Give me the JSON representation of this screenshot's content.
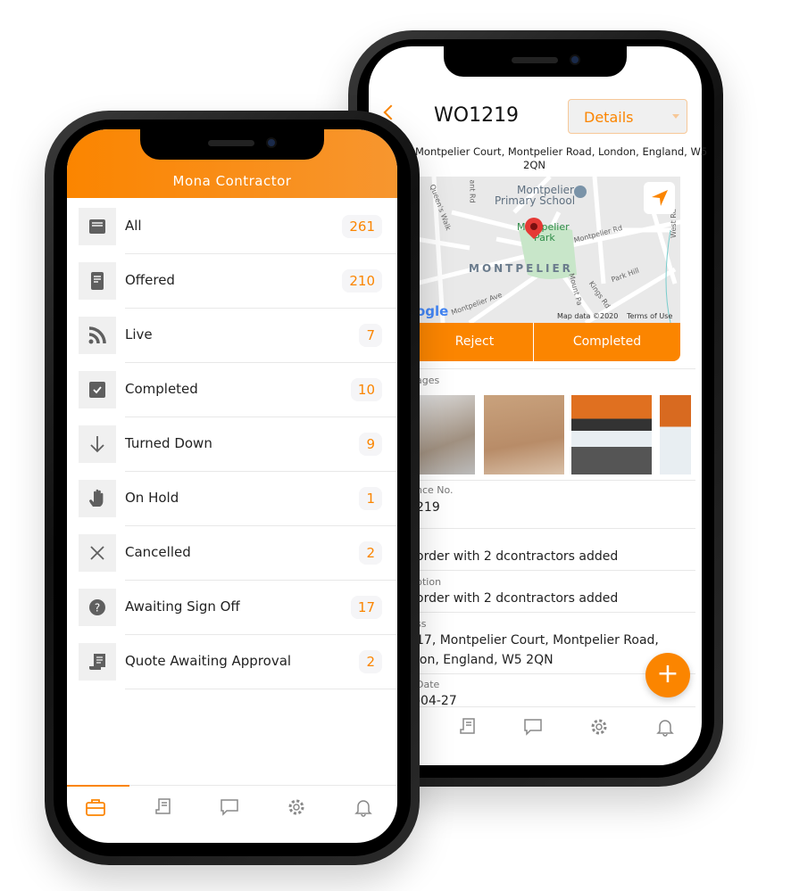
{
  "colors": {
    "accent": "#fb8500",
    "icon_grey": "#5f5f5f"
  },
  "detail_phone": {
    "title": "WO1219",
    "view_select": {
      "selected": "Details"
    },
    "address_line1": "Montpelier Court, Montpelier Road, London, England, W5",
    "address_line2": "2QN",
    "map": {
      "labels": {
        "school_1": "Montpelier",
        "school_2": "Primary School",
        "park_1": "Montpelier",
        "park_2": "Park",
        "area": "MONTPELIER",
        "road1": "Montpelier Rd",
        "road2": "Montpelier Ave",
        "road3": "Park Hill",
        "road4": "Mount Pa",
        "road5": "Kings Rd",
        "road6": "West Rd",
        "road7": "Queen's Walk",
        "road8": "ant Rd",
        "logo": "ogle",
        "attribution": "Map data ©2020",
        "terms": "Terms of Use"
      }
    },
    "actions": {
      "reject": "Reject",
      "completed": "Completed"
    },
    "images_label": "ages",
    "fields": [
      {
        "label": "nce No.",
        "value": "219"
      },
      {
        "label": "",
        "value": "order with 2 dcontractors added"
      },
      {
        "label": "ption",
        "value": "order with 2 dcontractors added"
      },
      {
        "label": "ss",
        "value": "17, Montpelier Court, Montpelier Road,",
        "value2": "lon, England, W5 2QN"
      },
      {
        "label": "Date",
        "value": "-04-27"
      }
    ],
    "fab": "+",
    "tabs": [
      "quotes-icon",
      "chat-icon",
      "settings-icon",
      "bell-icon"
    ]
  },
  "list_phone": {
    "title": "Mona Contractor",
    "items": [
      {
        "label": "All",
        "count": "261",
        "icon": "inbox-icon"
      },
      {
        "label": "Offered",
        "count": "210",
        "icon": "document-icon"
      },
      {
        "label": "Live",
        "count": "7",
        "icon": "rss-icon"
      },
      {
        "label": "Completed",
        "count": "10",
        "icon": "checkbox-icon"
      },
      {
        "label": "Turned Down",
        "count": "9",
        "icon": "arrow-down-icon"
      },
      {
        "label": "On Hold",
        "count": "1",
        "icon": "hand-icon"
      },
      {
        "label": "Cancelled",
        "count": "2",
        "icon": "close-icon"
      },
      {
        "label": "Awaiting Sign Off",
        "count": "17",
        "icon": "question-icon"
      },
      {
        "label": "Quote Awaiting Approval",
        "count": "2",
        "icon": "scroll-icon"
      }
    ],
    "tabs": [
      "briefcase-icon",
      "quotes-icon",
      "chat-icon",
      "settings-icon",
      "bell-icon"
    ],
    "active_tab": "briefcase-icon"
  }
}
